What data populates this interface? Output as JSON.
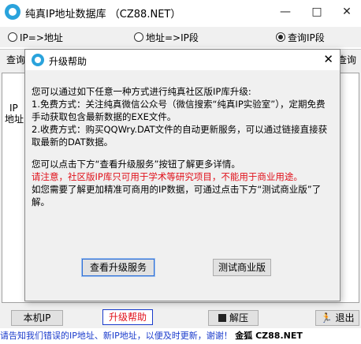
{
  "window": {
    "title": "纯真IP地址数据库 （CZ88.NET）",
    "minimize": "—",
    "maximize": "□",
    "close": "✕"
  },
  "radios": [
    {
      "label": "IP=>地址",
      "selected": false
    },
    {
      "label": "地址=>IP段",
      "selected": false
    },
    {
      "label": "查询IP段",
      "selected": true
    }
  ],
  "query_row": {
    "left_label": "查询",
    "right_label": "查询"
  },
  "left_column": {
    "line1": "IP",
    "line2": "地址"
  },
  "bottom_bar": {
    "local_ip": "本机IP",
    "upgrade_help": "升级帮助",
    "decompress": "解压",
    "exit": "退出"
  },
  "status_bar": {
    "text": "请告知我们错误的IP地址、新IP地址，以便及时更新，谢谢！",
    "brand": "金狐 CZ88.NET"
  },
  "dialog": {
    "title": "升级帮助",
    "close": "✕",
    "para1": "您可以通过如下任意一种方式进行纯真社区版IP库升级:",
    "para2": "1.免费方式：关注纯真微信公众号（微信搜索“纯真IP实验室”），定期免费手动获取包含最新数据的EXE文件。",
    "para3": "2.收费方式：购买QQWry.DAT文件的自动更新服务，可以通过链接直接获取最新的DAT数据。",
    "para4": "您可以点击下方“查看升级服务”按钮了解更多详情。",
    "para5": "请注意，社区版IP库只可用于学术等研究项目，不能用于商业用途。",
    "para6": "如您需要了解更加精准可商用的IP数据，可通过点击下方“测试商业版”了解。",
    "btn_view": "查看升级服务",
    "btn_test": "测试商业版"
  },
  "colors": {
    "accent": "#2aa3dc",
    "warning": "#e0101a",
    "status_text": "#1a3bcc"
  }
}
